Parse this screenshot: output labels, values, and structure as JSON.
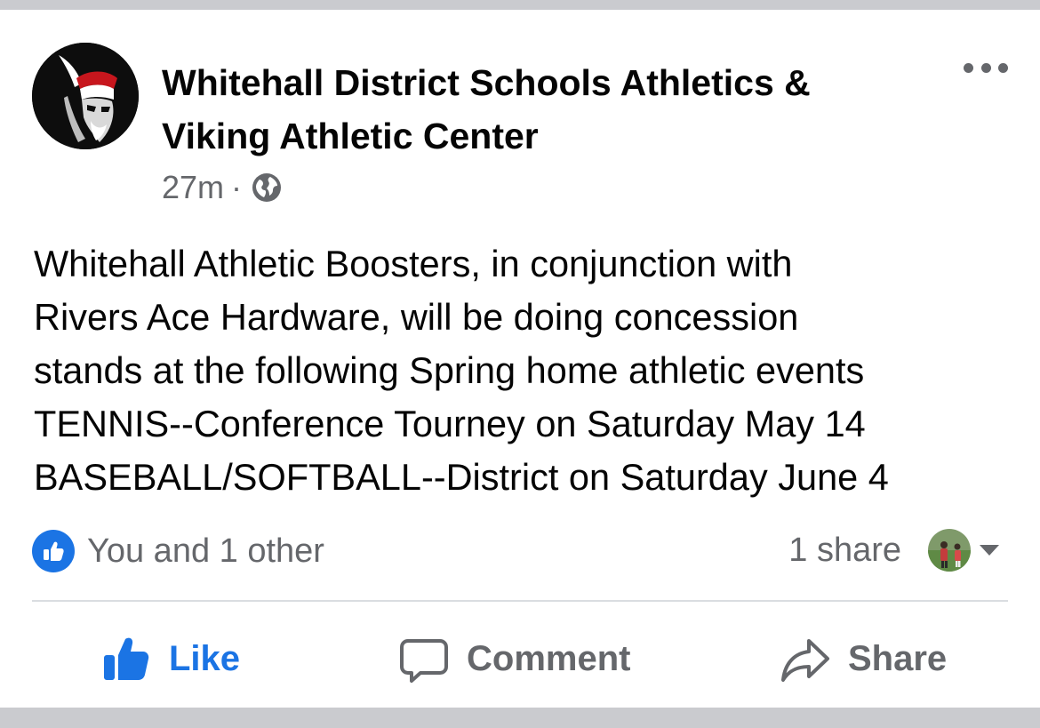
{
  "post": {
    "page_name": "Whitehall District Schools Athletics & Viking Athletic Center",
    "timestamp": "27m",
    "separator": "·",
    "audience_icon": "globe-icon",
    "avatar_icon": "viking-logo",
    "more_icon": "more-options-icon",
    "text_lines": [
      "Whitehall Athletic Boosters, in conjunction with",
      "Rivers Ace Hardware, will be doing concession",
      "stands at the following Spring home athletic events",
      "TENNIS--Conference Tourney on Saturday May 14",
      "BASEBALL/SOFTBALL--District on Saturday June 4"
    ]
  },
  "engagement": {
    "reaction_icon": "like-reaction-icon",
    "reactions_text": "You and 1 other",
    "shares_text": "1 share",
    "sharer_avatar": "sharer-avatar",
    "dropdown_icon": "caret-down-icon"
  },
  "actions": {
    "like_label": "Like",
    "comment_label": "Comment",
    "share_label": "Share"
  },
  "colors": {
    "accent": "#1b74e4",
    "secondary_text": "#65676b",
    "primary_text": "#050505",
    "background_bar": "#cacbcf"
  }
}
